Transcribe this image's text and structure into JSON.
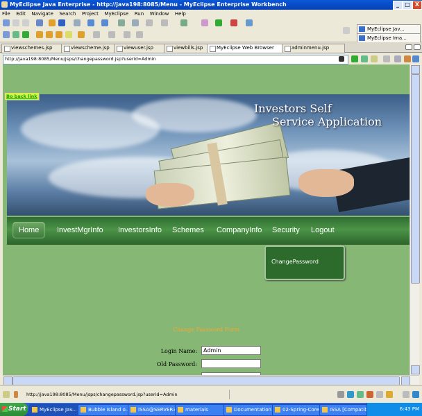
{
  "window": {
    "title": "MyEclipse Java Enterprise - http://java198:8085/Menu - MyEclipse Enterprise Workbench",
    "controls": [
      "_",
      "□",
      "X"
    ]
  },
  "menubar": [
    "File",
    "Edit",
    "Navigate",
    "Search",
    "Project",
    "MyEclipse",
    "Run",
    "Window",
    "Help"
  ],
  "perspectives": [
    "MyEclipse Jav...",
    "MyEclipse Ima..."
  ],
  "editor_tabs": [
    {
      "label": "viewschemes.jsp",
      "active": false
    },
    {
      "label": "viewscheme.jsp",
      "active": false
    },
    {
      "label": "viewuser.jsp",
      "active": false
    },
    {
      "label": "viewbills.jsp",
      "active": false
    },
    {
      "label": "MyEclipse Web Browser",
      "active": true
    },
    {
      "label": "adminmenu.jsp",
      "active": false
    }
  ],
  "browser": {
    "url": "http://java198:8085/Menu/jsps/changepassword.jsp?userid=Admin"
  },
  "page": {
    "back_link": "Bo back link",
    "banner_title_line1": "Investors Self",
    "banner_title_line2": "Service Application",
    "nav": [
      "Home",
      "InvestMgrInfo",
      "InvestorsInfo",
      "Schemes",
      "CompanyInfo",
      "Security",
      "Logout"
    ],
    "submenu_item": "ChangePassword",
    "form_title": "Change Password Form",
    "form": {
      "login_label": "Login Name:",
      "login_value": "Admin",
      "old_password_label": "Old Password:",
      "old_password_value": ""
    }
  },
  "statusbar": {
    "text": "http://java198:8085/Menu/jsps/changepassword.jsp?userid=Admin"
  },
  "taskbar": {
    "start": "Start",
    "items": [
      "MyEclipse Jav...",
      "Bubble Island o...",
      "ISSA@SERVER3",
      "materials",
      "Documentation",
      "02-Spring-Core...",
      "ISSA [Compatibi..."
    ],
    "clock": "6:43 PM"
  },
  "colors": {
    "page_background": "#86b775",
    "nav_green": "#4c9447",
    "form_title": "#f0a838"
  }
}
